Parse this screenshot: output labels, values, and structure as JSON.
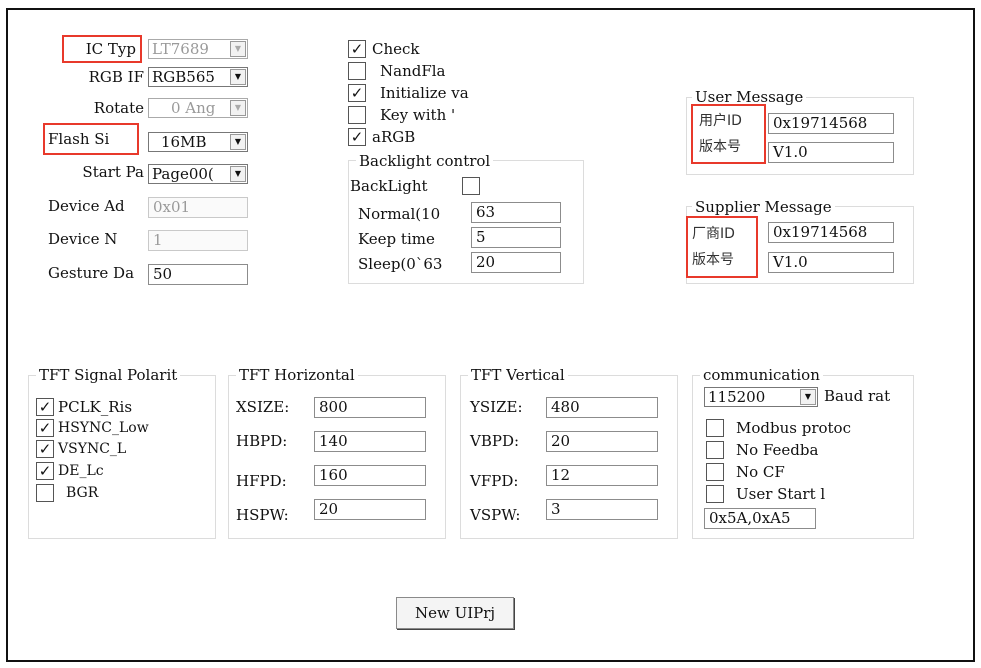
{
  "left_settings": {
    "ic_type": {
      "label": "IC Typ",
      "value": "LT7689"
    },
    "rgb_if": {
      "label": "RGB IF",
      "value": "RGB565"
    },
    "rotate": {
      "label": "Rotate",
      "value": "0 Ang"
    },
    "flash_size": {
      "label": "Flash Si",
      "value": "16MB"
    },
    "start_page": {
      "label": "Start Pa",
      "value": "Page00("
    },
    "device_addr": {
      "label": "Device Ad",
      "value": "0x01"
    },
    "device_n": {
      "label": "Device N",
      "value": "1"
    },
    "gesture": {
      "label": "Gesture Da",
      "value": "50"
    }
  },
  "options": [
    {
      "label": "Check",
      "checked": true
    },
    {
      "label": "NandFla",
      "checked": false
    },
    {
      "label": "Initialize va",
      "checked": true
    },
    {
      "label": "Key with '",
      "checked": false
    },
    {
      "label": "aRGB",
      "checked": true
    }
  ],
  "backlight": {
    "title": "Backlight control",
    "backlight_label": "BackLight",
    "backlight_checked": false,
    "normal": {
      "label": "Normal(10",
      "value": "63"
    },
    "keep_time": {
      "label": "Keep time",
      "value": "5"
    },
    "sleep": {
      "label": "Sleep(0`63",
      "value": "20"
    }
  },
  "user_message": {
    "title": "User Message",
    "id_label": "用户ID",
    "id_value": "0x19714568",
    "ver_label": "版本号",
    "ver_value": "V1.0"
  },
  "supplier_message": {
    "title": "Supplier Message",
    "id_label": "厂商ID",
    "id_value": "0x19714568",
    "ver_label": "版本号",
    "ver_value": "V1.0"
  },
  "polarity": {
    "title": "TFT Signal Polarit",
    "items": [
      {
        "label": "PCLK_Ris",
        "checked": true
      },
      {
        "label": "HSYNC_Low",
        "checked": true
      },
      {
        "label": "VSYNC_L",
        "checked": true
      },
      {
        "label": "DE_Lc",
        "checked": true
      },
      {
        "label": "BGR",
        "checked": false
      }
    ]
  },
  "horizontal": {
    "title": "TFT Horizontal",
    "xsize": {
      "label": "XSIZE:",
      "value": "800"
    },
    "hbpd": {
      "label": "HBPD:",
      "value": "140"
    },
    "hfpd": {
      "label": "HFPD:",
      "value": "160"
    },
    "hspw": {
      "label": "HSPW:",
      "value": "20"
    }
  },
  "vertical": {
    "title": "TFT Vertical",
    "ysize": {
      "label": "YSIZE:",
      "value": "480"
    },
    "vbpd": {
      "label": "VBPD:",
      "value": "20"
    },
    "vfpd": {
      "label": "VFPD:",
      "value": "12"
    },
    "vspw": {
      "label": "VSPW:",
      "value": "3"
    }
  },
  "communication": {
    "title": "communication",
    "baud_value": "115200",
    "baud_label": "Baud rat",
    "items": [
      {
        "label": "Modbus protoc",
        "checked": false
      },
      {
        "label": "No Feedba",
        "checked": false
      },
      {
        "label": "No CF",
        "checked": false
      },
      {
        "label": "User Start l",
        "checked": false
      }
    ],
    "start_bytes": "0x5A,0xA5"
  },
  "new_button": "New UIPrj",
  "colors": {
    "highlight": "#e8392b",
    "border": "#111111"
  },
  "check_glyph": "✓"
}
